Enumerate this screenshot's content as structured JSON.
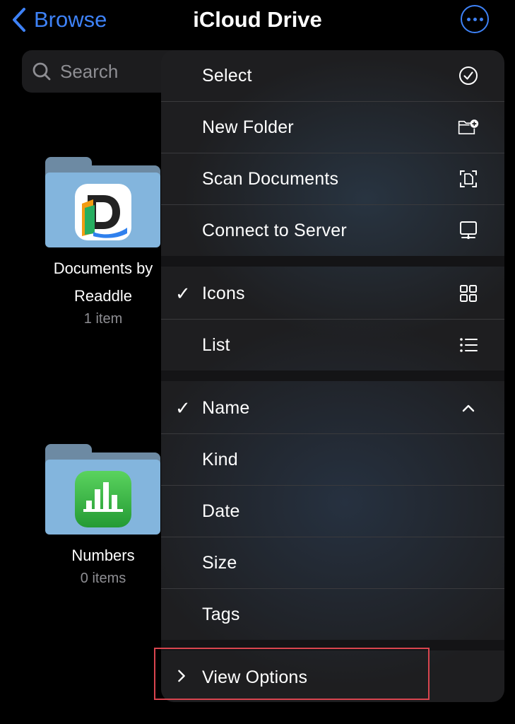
{
  "nav": {
    "back_label": "Browse",
    "title": "iCloud Drive"
  },
  "search": {
    "placeholder": "Search"
  },
  "folders": [
    {
      "name_line1": "Documents by",
      "name_line2": "Readdle",
      "count": "1 item"
    },
    {
      "name_line1": "Numbers",
      "count": "0 items"
    }
  ],
  "menu": {
    "actions": [
      {
        "label": "Select",
        "icon": "checkmark-circle-icon"
      },
      {
        "label": "New Folder",
        "icon": "folder-plus-icon"
      },
      {
        "label": "Scan Documents",
        "icon": "doc-scanner-icon"
      },
      {
        "label": "Connect to Server",
        "icon": "display-network-icon"
      }
    ],
    "view": [
      {
        "label": "Icons",
        "checked": true,
        "icon": "grid-icon"
      },
      {
        "label": "List",
        "checked": false,
        "icon": "list-icon"
      }
    ],
    "sort": [
      {
        "label": "Name",
        "checked": true,
        "icon": "chevron-up-icon"
      },
      {
        "label": "Kind"
      },
      {
        "label": "Date"
      },
      {
        "label": "Size"
      },
      {
        "label": "Tags"
      }
    ],
    "view_options": {
      "label": "View Options",
      "icon": "chevron-right-icon"
    }
  },
  "colors": {
    "accent": "#3e82f7",
    "highlight_border": "#d9454f",
    "menu_bg": "#1e1e20",
    "numbers_green": "#34c759"
  }
}
